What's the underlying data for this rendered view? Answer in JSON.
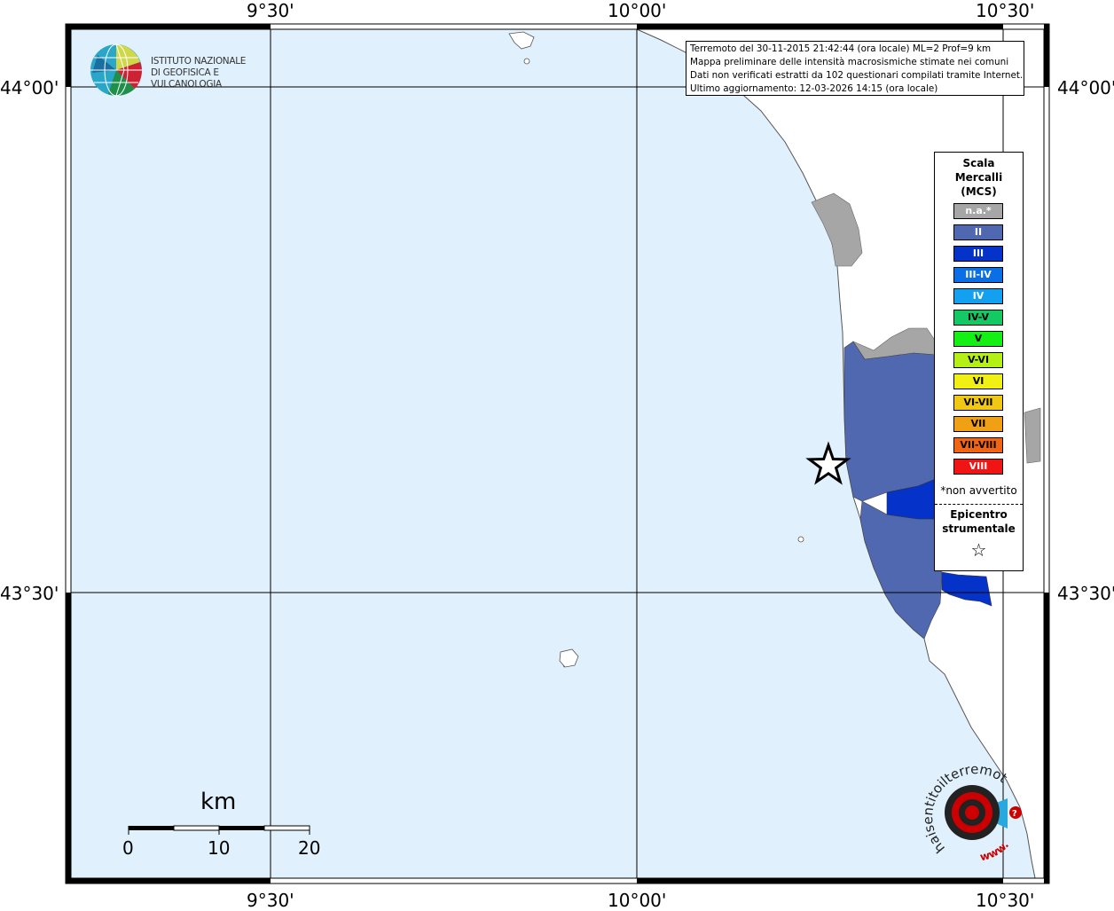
{
  "info": {
    "line1": "Terremoto del 30-11-2015 21:42:44 (ora locale) ML=2 Prof=9 km",
    "line2": "Mappa preliminare delle intensità macrosismiche stimate nei comuni",
    "line3": "Dati non verificati estratti da 102 questionari compilati tramite Internet.",
    "line4": "Ultimo aggiornamento: 12-03-2026 14:15 (ora locale)"
  },
  "logo_ingv": {
    "line1": "ISTITUTO NAZIONALE",
    "line2": "DI GEOFISICA E VULCANOLOGIA",
    "icon": "globe-logo-icon"
  },
  "axes": {
    "lon_labels": [
      "9°30'",
      "10°00'",
      "10°30'"
    ],
    "lat_labels": [
      "44°00'",
      "43°30'"
    ]
  },
  "legend": {
    "title_line1": "Scala",
    "title_line2": "Mercalli",
    "title_line3": "(MCS)",
    "items": [
      {
        "label": "n.a.*",
        "color": "#a6a6a6",
        "text_color": "#ffffff"
      },
      {
        "label": "II",
        "color": "#5068b0",
        "text_color": "#ffffff"
      },
      {
        "label": "III",
        "color": "#0532c8",
        "text_color": "#ffffff"
      },
      {
        "label": "III-IV",
        "color": "#0a6ee6",
        "text_color": "#ffffff"
      },
      {
        "label": "IV",
        "color": "#14a0f0",
        "text_color": "#ffffff"
      },
      {
        "label": "IV-V",
        "color": "#14c864",
        "text_color": "#000000"
      },
      {
        "label": "V",
        "color": "#14f014",
        "text_color": "#000000"
      },
      {
        "label": "V-VI",
        "color": "#b4f014",
        "text_color": "#000000"
      },
      {
        "label": "VI",
        "color": "#f0f014",
        "text_color": "#000000"
      },
      {
        "label": "VI-VII",
        "color": "#f0c814",
        "text_color": "#000000"
      },
      {
        "label": "VII",
        "color": "#f0a014",
        "text_color": "#000000"
      },
      {
        "label": "VII-VIII",
        "color": "#f06414",
        "text_color": "#000000"
      },
      {
        "label": "VIII",
        "color": "#f01414",
        "text_color": "#ffffff"
      }
    ],
    "note": "*non avvertito",
    "epicenter_line1": "Epicentro",
    "epicenter_line2": "strumentale",
    "epicenter_icon": "star-icon"
  },
  "scale_bar": {
    "unit": "km",
    "labels": [
      "0",
      "10",
      "20"
    ]
  },
  "logo_hsit": {
    "text": "haisentitoilterremoto.it?",
    "url_text": "www.",
    "icon": "target-logo-icon"
  },
  "colors": {
    "sea": "#e0f0fc",
    "land": "#ffffff",
    "na": "#a6a6a6",
    "II": "#5068b0",
    "III": "#0532c8"
  }
}
